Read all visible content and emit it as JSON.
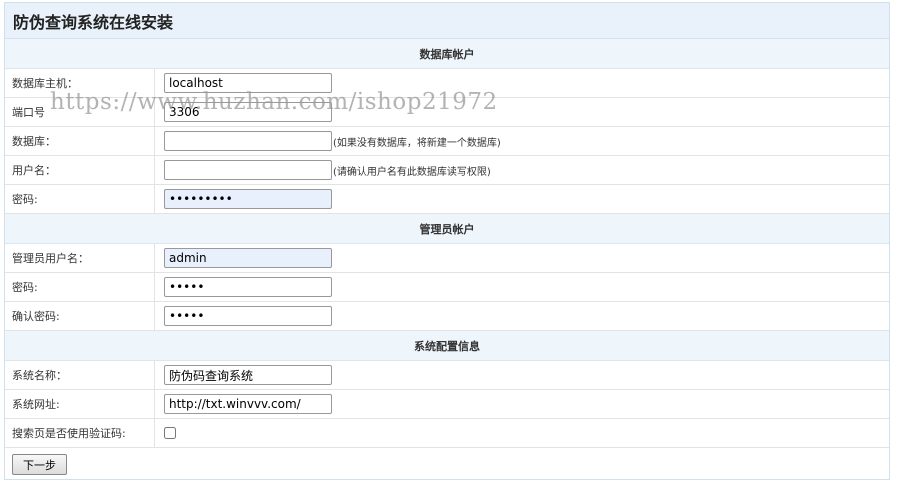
{
  "title": "防伪查询系统在线安装",
  "watermark": "https://www.huzhan.com/ishop21972",
  "sections": {
    "db": {
      "heading": "数据库帐户",
      "host_label": "数据库主机：",
      "host_value": "localhost",
      "port_label": "端口号",
      "port_value": "3306",
      "name_label": "数据库：",
      "name_value": "",
      "name_hint": "(如果没有数据库，将新建一个数据库)",
      "user_label": "用户名：",
      "user_value": "",
      "user_hint": "(请确认用户名有此数据库读写权限)",
      "pass_label": "密码:",
      "pass_value": "•••••••••"
    },
    "admin": {
      "heading": "管理员帐户",
      "user_label": "管理员用户名：",
      "user_value": "admin",
      "pass_label": "密码:",
      "pass_value": "•••••",
      "confirm_label": "确认密码:",
      "confirm_value": "•••••"
    },
    "config": {
      "heading": "系统配置信息",
      "name_label": "系统名称：",
      "name_value": "防伪码查询系统",
      "url_label": "系统网址:",
      "url_value": "http://txt.winvvv.com/",
      "captcha_label": "搜索页是否使用验证码:"
    }
  },
  "next_button": "下一步"
}
